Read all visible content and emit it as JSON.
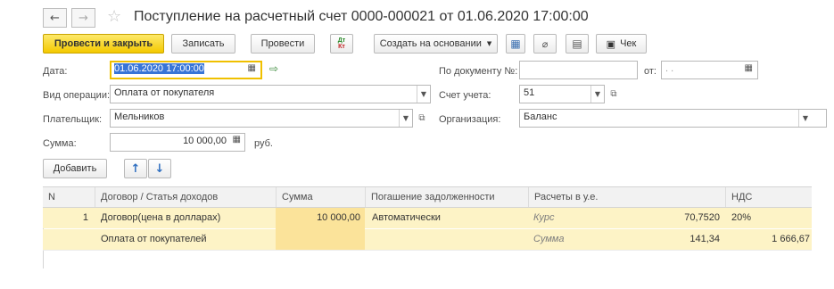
{
  "window": {
    "title": "Поступление на расчетный счет 0000-000021 от 01.06.2020 17:00:00"
  },
  "toolbar": {
    "post_close": "Провести и закрыть",
    "save": "Записать",
    "post": "Провести",
    "dtkt_top": "Дт",
    "dtkt_bottom": "Кт",
    "create_based": "Создать на основании",
    "receipt": "Чек"
  },
  "form": {
    "date_label": "Дата:",
    "date_value": "01.06.2020 17:00:00",
    "doc_num_label": "По документу №:",
    "doc_num_value": "",
    "from_label": "от:",
    "from_value": " .  .",
    "op_type_label": "Вид операции:",
    "op_type_value": "Оплата от покупателя",
    "account_label": "Счет учета:",
    "account_value": "51",
    "payer_label": "Плательщик:",
    "payer_value": "Мельников",
    "org_label": "Организация:",
    "org_value": "Баланс",
    "sum_label": "Сумма:",
    "sum_value": "10 000,00",
    "currency": "руб."
  },
  "table_toolbar": {
    "add": "Добавить"
  },
  "table": {
    "headers": [
      "N",
      "Договор / Статья доходов",
      "Сумма",
      "Погашение задолженности",
      "Расчеты в у.е.",
      "НДС"
    ],
    "row1": {
      "n": "1",
      "contract": "Договор(цена в долларах)",
      "sum": "10 000,00",
      "repay": "Автоматически",
      "rate_label": "Курс",
      "rate_value": "70,7520",
      "vat_rate": "20%"
    },
    "row2": {
      "item": "Оплата от покупателей",
      "sum_label": "Сумма",
      "sum_value": "141,34",
      "vat_sum": "1 666,67"
    }
  },
  "colors": {
    "primary_button": "#f4c900",
    "row_highlight": "#fdf3c6",
    "sum_cell": "#fbe39a",
    "date_focus_border": "#f0c000"
  }
}
